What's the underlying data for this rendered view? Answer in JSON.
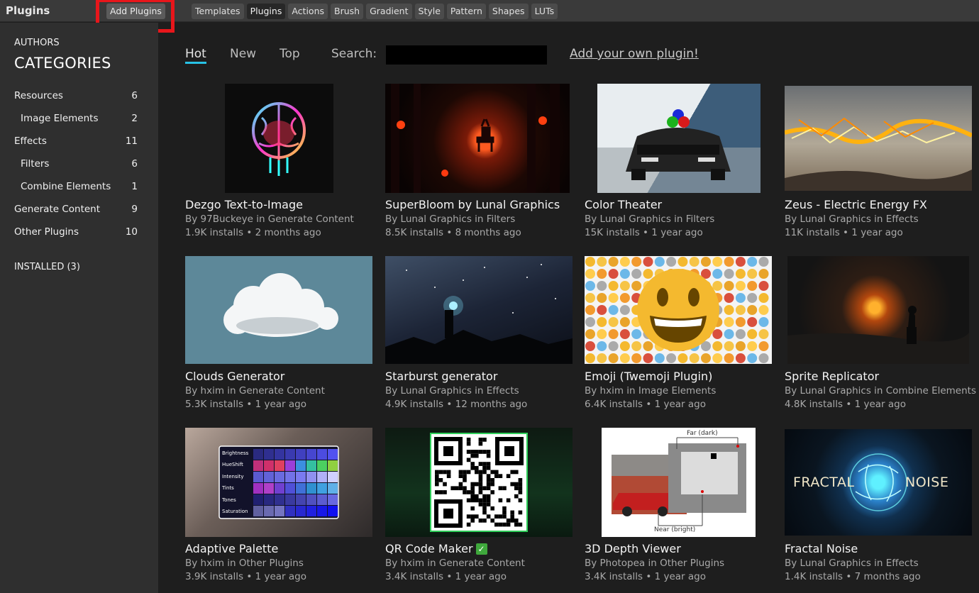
{
  "app": {
    "title": "Plugins",
    "add_plugins_label": "Add Plugins"
  },
  "type_tabs": [
    "Templates",
    "Plugins",
    "Actions",
    "Brush",
    "Gradient",
    "Style",
    "Pattern",
    "Shapes",
    "LUTs"
  ],
  "active_type_tab": "Plugins",
  "sidebar": {
    "authors": "AUTHORS",
    "categories_heading": "CATEGORIES",
    "categories": [
      {
        "label": "Resources",
        "count": "6"
      },
      {
        "label": "Image Elements",
        "count": "2"
      },
      {
        "label": "Effects",
        "count": "11"
      },
      {
        "label": "Filters",
        "count": "6"
      },
      {
        "label": "Combine Elements",
        "count": "1"
      },
      {
        "label": "Generate Content",
        "count": "9"
      },
      {
        "label": "Other Plugins",
        "count": "10"
      }
    ],
    "installed": "INSTALLED (3)"
  },
  "sort_tabs": [
    "Hot",
    "New",
    "Top"
  ],
  "active_sort_tab": "Hot",
  "search": {
    "label": "Search:",
    "value": ""
  },
  "add_own_plugin": "Add your own plugin!",
  "plugins": [
    {
      "title": "Dezgo Text-to-Image",
      "byline": "By 97Buckeye in Generate Content",
      "stats": "1.9K installs • 2 months ago",
      "verified": false
    },
    {
      "title": "SuperBloom by Lunal Graphics",
      "byline": "By Lunal Graphics in Filters",
      "stats": "8.5K installs • 8 months ago",
      "verified": false
    },
    {
      "title": "Color Theater",
      "byline": "By Lunal Graphics in Filters",
      "stats": "15K installs • 1 year ago",
      "verified": false
    },
    {
      "title": "Zeus - Electric Energy FX",
      "byline": "By Lunal Graphics in Effects",
      "stats": "11K installs • 1 year ago",
      "verified": false
    },
    {
      "title": "Clouds Generator",
      "byline": "By hxim in Generate Content",
      "stats": "5.3K installs • 1 year ago",
      "verified": false
    },
    {
      "title": "Starburst generator",
      "byline": "By Lunal Graphics in Effects",
      "stats": "4.9K installs • 12 months ago",
      "verified": false
    },
    {
      "title": "Emoji (Twemoji Plugin)",
      "byline": "By hxim in Image Elements",
      "stats": "6.4K installs • 1 year ago",
      "verified": false
    },
    {
      "title": "Sprite Replicator",
      "byline": "By Lunal Graphics in Combine Elements",
      "stats": "4.8K installs • 1 year ago",
      "verified": false
    },
    {
      "title": "Adaptive Palette",
      "byline": "By hxim in Other Plugins",
      "stats": "3.9K installs • 1 year ago",
      "verified": false
    },
    {
      "title": "QR Code Maker",
      "byline": "By hxim in Generate Content",
      "stats": "3.4K installs • 1 year ago",
      "verified": true
    },
    {
      "title": "3D Depth Viewer",
      "byline": "By Photopea in Other Plugins",
      "stats": "3.4K installs • 1 year ago",
      "verified": false
    },
    {
      "title": "Fractal Noise",
      "byline": "By Lunal Graphics in Effects",
      "stats": "1.4K installs • 7 months ago",
      "verified": false
    }
  ],
  "thumb_text": {
    "palette_rows": [
      "Brightness",
      "HueShift",
      "Intensity",
      "Tints",
      "Tones",
      "Saturation"
    ],
    "depth_far": "Far (dark)",
    "depth_near": "Near (bright)",
    "fractal_left": "FRACTAL",
    "fractal_right": "NOISE"
  },
  "colors": {
    "accent": "#27c2e6",
    "highlight": "#e8161b",
    "verified": "#3fa83c"
  }
}
